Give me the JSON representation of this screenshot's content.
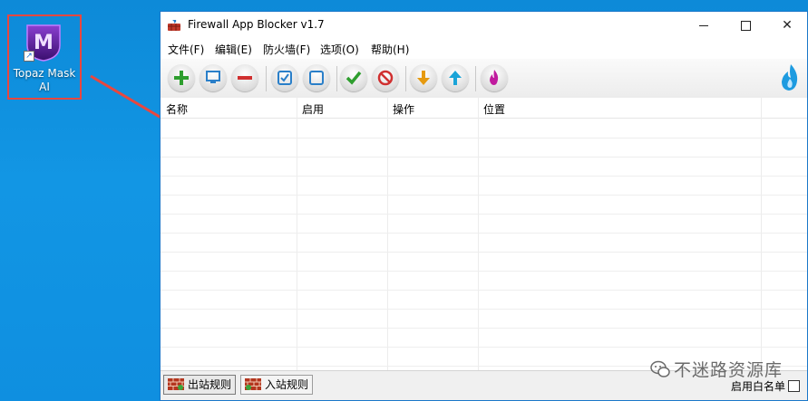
{
  "desktop": {
    "shortcut_label": "Topaz Mask AI"
  },
  "window": {
    "title": "Firewall App Blocker v1.7",
    "controls": {
      "minimize": "minimize",
      "maximize": "maximize",
      "close": "✕"
    }
  },
  "menu": [
    {
      "label": "文件(F)"
    },
    {
      "label": "编辑(E)"
    },
    {
      "label": "防火墙(F)"
    },
    {
      "label": "选项(O)"
    },
    {
      "label": "帮助(H)"
    }
  ],
  "toolbar": {
    "buttons": [
      {
        "icon": "add-icon",
        "color": "#2e9e2e"
      },
      {
        "icon": "monitor-icon",
        "color": "#2a7fc9"
      },
      {
        "icon": "remove-icon",
        "color": "#d03030"
      },
      {
        "icon": "check-box-icon",
        "color": "#2a7fc9"
      },
      {
        "icon": "uncheck-box-icon",
        "color": "#2a7fc9"
      },
      {
        "icon": "allow-check-icon",
        "color": "#2e9e2e"
      },
      {
        "icon": "block-icon",
        "color": "#d03030"
      },
      {
        "icon": "arrow-down-icon",
        "color": "#e69a10"
      },
      {
        "icon": "arrow-up-icon",
        "color": "#1aa4d8"
      },
      {
        "icon": "fire-icon",
        "color": "#c01a9e"
      }
    ],
    "brand_icon": "flame-logo-icon"
  },
  "table": {
    "columns": [
      "名称",
      "启用",
      "操作",
      "位置"
    ],
    "rows": []
  },
  "status": {
    "tabs": [
      {
        "label": "出站规则",
        "active": true
      },
      {
        "label": "入站规则",
        "active": false
      }
    ],
    "whitelist_label": "启用白名单",
    "whitelist_checked": false
  },
  "watermark": {
    "text": "不迷路资源库"
  },
  "colors": {
    "desktop": "#0f8fe0",
    "window_border": "#1a77c9",
    "annotation": "#e8473f"
  }
}
